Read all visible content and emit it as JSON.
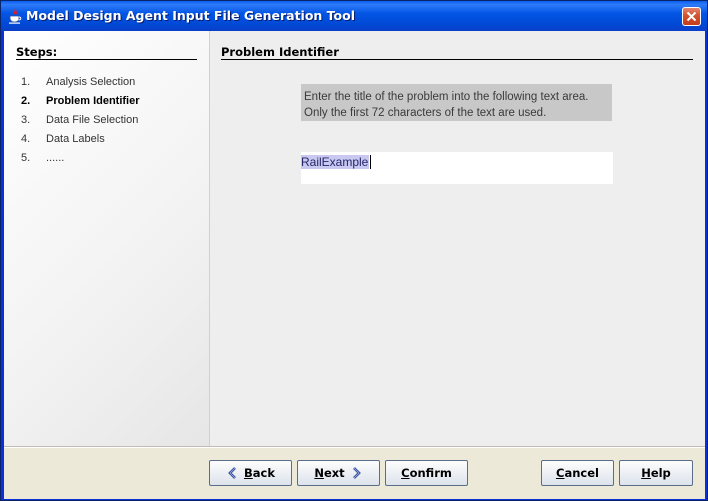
{
  "window": {
    "title": "Model Design Agent Input File Generation Tool",
    "icon": "java-cup-icon",
    "close_icon": "close-icon",
    "colors": {
      "titlebar": "#0456e6",
      "close": "#d2512f"
    }
  },
  "steps": {
    "title": "Steps:",
    "items": [
      {
        "num": "1.",
        "label": "Analysis Selection"
      },
      {
        "num": "2.",
        "label": "Problem Identifier",
        "current": true
      },
      {
        "num": "3.",
        "label": "Data File Selection"
      },
      {
        "num": "4.",
        "label": "Data Labels"
      },
      {
        "num": "5.",
        "label": "......"
      }
    ]
  },
  "panel": {
    "title": "Problem Identifier",
    "instruction_line1": "Enter the title of the problem into the following text area.",
    "instruction_line2": "Only the first 72 characters of the text are used.",
    "text_value": "RailExample"
  },
  "footer": {
    "back_label": "Back",
    "next_label": "Next",
    "confirm_label": "Confirm",
    "cancel_label": "Cancel",
    "help_label": "Help",
    "back_icon": "chevron-left-icon",
    "next_icon": "chevron-right-icon"
  }
}
